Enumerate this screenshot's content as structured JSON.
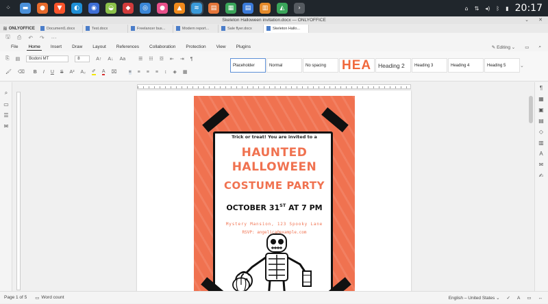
{
  "taskbar": {
    "apps": [
      {
        "icon": "launcher-icon",
        "glyph": "⁘",
        "color": "#20262c"
      },
      {
        "icon": "files-icon",
        "glyph": "▬",
        "color": "#4a90d9"
      },
      {
        "icon": "firefox-icon",
        "glyph": "●",
        "color": "#e66a2c"
      },
      {
        "icon": "brave-icon",
        "glyph": "▼",
        "color": "#fb542b"
      },
      {
        "icon": "edge-icon",
        "glyph": "◐",
        "color": "#1e8fd6"
      },
      {
        "icon": "chrome-icon",
        "glyph": "◉",
        "color": "#3e6fd6"
      },
      {
        "icon": "android-icon",
        "glyph": "◒",
        "color": "#8cc24a"
      },
      {
        "icon": "ruby-icon",
        "glyph": "◆",
        "color": "#d13b3b"
      },
      {
        "icon": "network-icon",
        "glyph": "◎",
        "color": "#3a86d6"
      },
      {
        "icon": "chat-icon",
        "glyph": "●",
        "color": "#e8508a"
      },
      {
        "icon": "vlc-icon",
        "glyph": "▲",
        "color": "#f08a1c"
      },
      {
        "icon": "onlyoffice-icon",
        "glyph": "≋",
        "color": "#3a9ad9"
      },
      {
        "icon": "presentation-icon",
        "glyph": "▤",
        "color": "#e5763a"
      },
      {
        "icon": "spreadsheet-icon",
        "glyph": "▦",
        "color": "#3aa55a"
      },
      {
        "icon": "document-icon",
        "glyph": "▤",
        "color": "#3a7ad9"
      },
      {
        "icon": "chart-icon",
        "glyph": "▥",
        "color": "#e58a2a"
      },
      {
        "icon": "image-icon",
        "glyph": "◭",
        "color": "#3aa55a"
      },
      {
        "icon": "terminal-icon",
        "glyph": "›",
        "color": "#555a60"
      }
    ],
    "tray_icons": [
      "pin-icon",
      "network-icon",
      "volume-icon",
      "bluetooth-icon",
      "battery-icon"
    ],
    "clock": "20:17"
  },
  "window": {
    "title": "Skeleton Halloween invitation.docx — ONLYOFFICE"
  },
  "tabs": {
    "logo": "ONLYOFFICE",
    "items": [
      {
        "label": "Document1.docx",
        "active": false
      },
      {
        "label": "Test.docx",
        "active": false
      },
      {
        "label": "Freelancer bus...",
        "active": false
      },
      {
        "label": "Modern report...",
        "active": false
      },
      {
        "label": "Sale flyer.docx",
        "active": false
      },
      {
        "label": "Skeleton Hallo...",
        "active": true
      }
    ]
  },
  "menu": {
    "items": [
      "File",
      "Home",
      "Insert",
      "Draw",
      "Layout",
      "References",
      "Collaboration",
      "Protection",
      "View",
      "Plugins"
    ],
    "active": "Home",
    "editing": "Editing"
  },
  "ribbon": {
    "font_name": "Bodoni MT",
    "font_size": "8",
    "styles": [
      {
        "label": "Placeholder",
        "kind": "small"
      },
      {
        "label": "Normal",
        "kind": "small"
      },
      {
        "label": "No spacing",
        "kind": "small"
      },
      {
        "label": "HEA",
        "kind": "big"
      },
      {
        "label": "Heading 2",
        "kind": "h"
      },
      {
        "label": "Heading 3",
        "kind": "small"
      },
      {
        "label": "Heading 4",
        "kind": "small"
      },
      {
        "label": "Heading 5",
        "kind": "small"
      }
    ]
  },
  "poster": {
    "invite": "Trick or treat! You are invited to a",
    "title_line1": "HAUNTED",
    "title_line2": "HALLOWEEN",
    "subtitle": "COSTUME PARTY",
    "date_prefix": "OCTOBER 31",
    "date_sup": "ST",
    "date_suffix": " AT 7 PM",
    "location": "Mystery Mansion, 123 Spooky Lane",
    "rsvp": "RSVP: angelica@example.com"
  },
  "status": {
    "page": "Page 1 of 5",
    "word_count": "Word count",
    "language": "English – United States"
  }
}
